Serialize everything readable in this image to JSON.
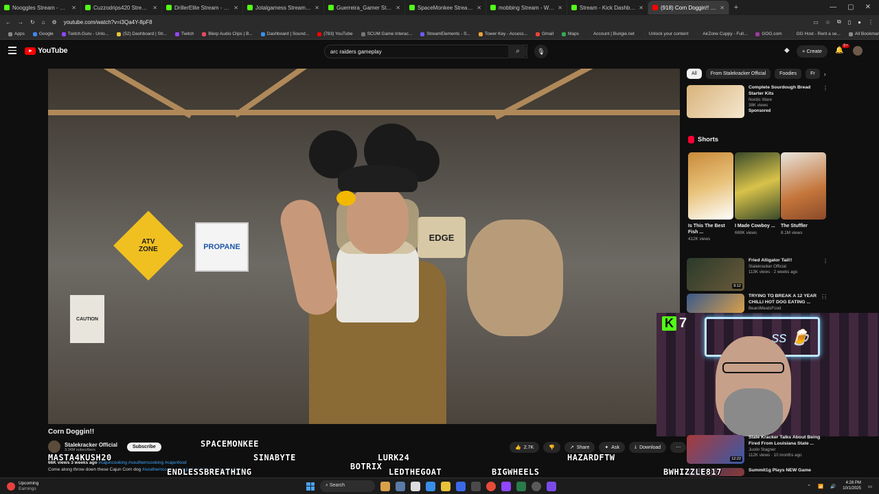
{
  "browser": {
    "tabs": [
      {
        "label": "Nooggles Stream - Watch Live",
        "color": "#53fc18"
      },
      {
        "label": "Cuzzodrips420 Stream - Watch",
        "color": "#53fc18"
      },
      {
        "label": "DrillerElite Stream - Watch Live",
        "color": "#53fc18"
      },
      {
        "label": "Jotalgamess Stream - Watch Li",
        "color": "#53fc18"
      },
      {
        "label": "Guerreira_Gamer Stream - Wat",
        "color": "#53fc18"
      },
      {
        "label": "SpaceMonkee Stream - Watch",
        "color": "#53fc18"
      },
      {
        "label": "mobbing Stream - Watch Live",
        "color": "#53fc18"
      },
      {
        "label": "Stream - Kick Dashboard",
        "color": "#53fc18"
      },
      {
        "label": "(918) Corn Doggin!! - YouT",
        "color": "#ff0000"
      }
    ],
    "url": "youtube.com/watch?v=i3Qa4Y-8pF8",
    "bookmarks": [
      {
        "label": "Apps",
        "color": "#888888"
      },
      {
        "label": "Google",
        "color": "#4285f4"
      },
      {
        "label": "Twitch.Guru - Unlo...",
        "color": "#9146ff"
      },
      {
        "label": "(52) Dashboard | Str...",
        "color": "#e8c33a"
      },
      {
        "label": "Twitch",
        "color": "#9146ff"
      },
      {
        "label": "Blerp Audio Clips | B...",
        "color": "#e84a5f"
      },
      {
        "label": "Dashboard | Sound...",
        "color": "#3a8ee8"
      },
      {
        "label": "(783) YouTube",
        "color": "#ff0000"
      },
      {
        "label": "SCUM Game Interac...",
        "color": "#777777"
      },
      {
        "label": "StreamElements - S...",
        "color": "#6b5cff"
      },
      {
        "label": "Tower Key - Access...",
        "color": "#e8a33a"
      },
      {
        "label": "Gmail",
        "color": "#ea4335"
      },
      {
        "label": "Maps",
        "color": "#34a853"
      },
      {
        "label": "Account | Bungie.net",
        "color": "#2d2d2d"
      },
      {
        "label": "Unlock your content",
        "color": "#2d2d2d"
      },
      {
        "label": "AirZone Cuppy - Full...",
        "color": "#2d2d2d"
      },
      {
        "label": "GOG.com",
        "color": "#9c3aa3"
      },
      {
        "label": "GG Host - Rent a se...",
        "color": "#2d2d2d"
      },
      {
        "label": "All Bookmarks",
        "color": "#888888"
      }
    ]
  },
  "youtube": {
    "logo": "YouTube",
    "search_value": "arc raiders gameplay",
    "create_label": "Create",
    "notif_badge": "9+"
  },
  "video": {
    "title": "Corn Doggin!!",
    "channel": "Stalekracker Official",
    "subscribers": "3.34M subscribers",
    "subscribe_label": "Subscribe",
    "likes": "2.7K",
    "share": "Share",
    "ask": "Ask",
    "download": "Download",
    "views": "66K views",
    "age": "3 weeks ago",
    "tags_top": "#cajuncooking #southerncooking #cajunfood",
    "desc_prefix": "Come along",
    "desc_middle": "throw down these Cajun Corn dog",
    "tags_bottom": "#southerncooking #cajunfood #louisianaeats #foodie"
  },
  "overlay": {
    "kick_count": "7",
    "names": [
      "SPACEMONKEE",
      "MASTA4KUSH20",
      "SINABYTE",
      "LURK24",
      "HAZARDFTW",
      "BOTRIX",
      "ENDLESSBREATHING",
      "LEDTHEGOAT",
      "BIGWHEELS",
      "BWHIZZLE817"
    ]
  },
  "sidebar": {
    "chips": [
      "All",
      "From Stalekracker Official",
      "Foodies",
      "Fr"
    ],
    "ad": {
      "title": "Complete Sourdough Bread Starter Kits",
      "brand": "Nordic Ware",
      "views": "38K views",
      "label": "Sponsored"
    },
    "shorts_title": "Shorts",
    "shorts": [
      {
        "title": "Is This The Best Fish ...",
        "views": "412K views"
      },
      {
        "title": "I Made Cowboy ...",
        "views": "669K views"
      },
      {
        "title": "The Stuffler",
        "views": "8.1M views"
      }
    ],
    "recs": [
      {
        "title": "Fried Alligator Tail!!",
        "channel": "Stalekracker Official",
        "meta": "113K views · 2 weeks ago",
        "duration": "9:12"
      },
      {
        "title": "TRYING TO BREAK A 12 YEAR CHILLI HOT DOG EATING ...",
        "channel": "BeardMeatsFood",
        "meta": "",
        "duration": ""
      },
      {
        "title": "Stale Kracker Talks About Being Fired From Louisiana State ...",
        "channel": "Justin Stagner",
        "meta": "112K views · 10 months ago",
        "duration": "12:22"
      },
      {
        "title": "Summit1g Plays NEW Game",
        "channel": "",
        "meta": "",
        "duration": ""
      }
    ]
  },
  "taskbar": {
    "weather_title": "Upcoming",
    "weather_sub": "Earnings",
    "search": "Search",
    "time": "4:28 PM",
    "date": "10/1/2025"
  }
}
